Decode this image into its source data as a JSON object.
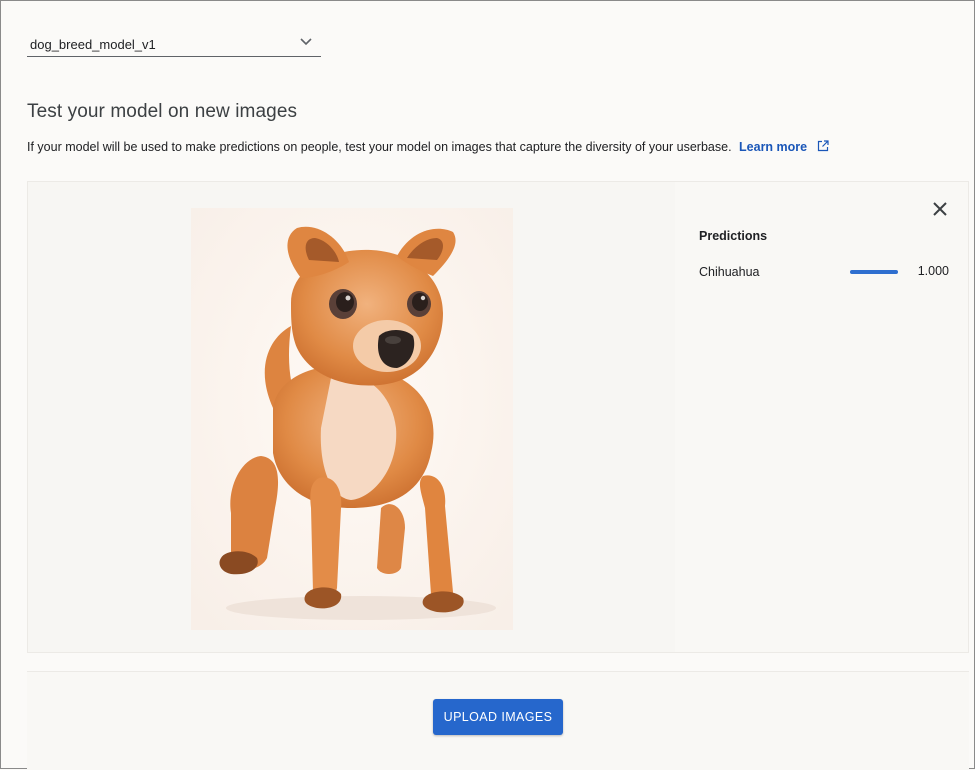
{
  "model_selector": {
    "value": "dog_breed_model_v1",
    "icon": "chevron-down-icon"
  },
  "heading": "Test your model on new images",
  "description": {
    "text": "If your model will be used to make predictions on people, test your model on images that capture the diversity of your userbase.",
    "link_label": "Learn more",
    "link_icon": "external-link-icon"
  },
  "result": {
    "image_subject": "chihuahua puppy photo",
    "close_icon": "close-icon",
    "predictions_title": "Predictions",
    "predictions": [
      {
        "label": "Chihuahua",
        "score": "1.000",
        "confidence": 1.0
      }
    ]
  },
  "upload": {
    "button_label": "UPLOAD IMAGES"
  },
  "colors": {
    "accent": "#2667cc",
    "link": "#1a56b8",
    "bar": "#2f6fcf"
  }
}
